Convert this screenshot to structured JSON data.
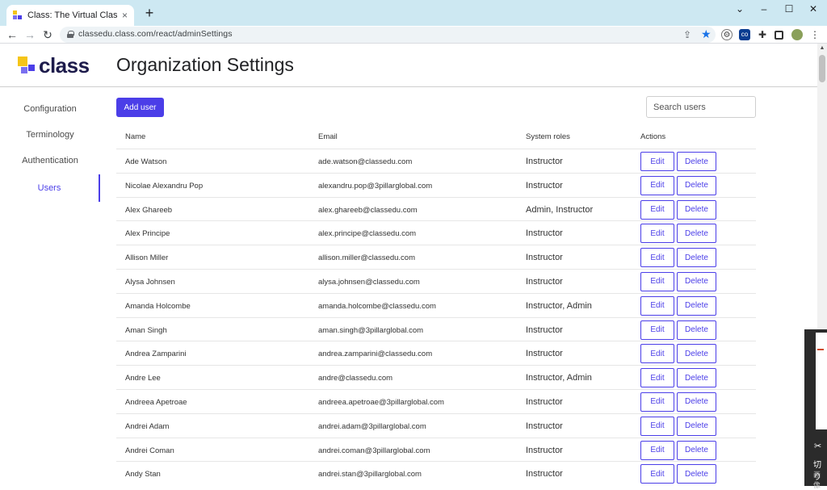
{
  "browser": {
    "tab_title": "Class: The Virtual Classroom Buil",
    "tab_close": "×",
    "new_tab": "+",
    "url": "classedu.class.com/react/adminSettings",
    "controls": {
      "back": "←",
      "forward": "→",
      "reload": "↻"
    },
    "window": {
      "minimize": "–",
      "maximize": "☐",
      "close": "✕"
    },
    "extensions": [
      "gear-icon",
      "co-icon",
      "puzzle-icon",
      "sidepanel-icon",
      "avatar",
      "menu-icon"
    ],
    "extension_label_co": "co"
  },
  "app": {
    "logo_text": "class",
    "page_title": "Organization Settings",
    "brand_color": "#4b3ee8",
    "logo_colors": [
      "#f5c518",
      "#4b3ee8",
      "#7a6ff0"
    ]
  },
  "sidebar": {
    "items": [
      {
        "label": "Configuration",
        "active": false
      },
      {
        "label": "Terminology",
        "active": false
      },
      {
        "label": "Authentication",
        "active": false
      },
      {
        "label": "Users",
        "active": true
      }
    ]
  },
  "users": {
    "add_label": "Add user",
    "search_placeholder": "Search users",
    "columns": {
      "name": "Name",
      "email": "Email",
      "roles": "System roles",
      "actions": "Actions"
    },
    "edit_label": "Edit",
    "delete_label": "Delete",
    "rows": [
      {
        "name": "Ade Watson",
        "email": "ade.watson@classedu.com",
        "roles": "Instructor"
      },
      {
        "name": "Nicolae Alexandru Pop",
        "email": "alexandru.pop@3pillarglobal.com",
        "roles": "Instructor"
      },
      {
        "name": "Alex Ghareeb",
        "email": "alex.ghareeb@classedu.com",
        "roles": "Admin, Instructor"
      },
      {
        "name": "Alex Principe",
        "email": "alex.principe@classedu.com",
        "roles": "Instructor"
      },
      {
        "name": "Allison Miller",
        "email": "allison.miller@classedu.com",
        "roles": "Instructor"
      },
      {
        "name": "Alysa Johnsen",
        "email": "alysa.johnsen@classedu.com",
        "roles": "Instructor"
      },
      {
        "name": "Amanda Holcombe",
        "email": "amanda.holcombe@classedu.com",
        "roles": "Instructor, Admin"
      },
      {
        "name": "Aman Singh",
        "email": "aman.singh@3pillarglobal.com",
        "roles": "Instructor"
      },
      {
        "name": "Andrea Zamparini",
        "email": "andrea.zamparini@classedu.com",
        "roles": "Instructor"
      },
      {
        "name": "Andre Lee",
        "email": "andre@classedu.com",
        "roles": "Instructor, Admin"
      },
      {
        "name": "Andreea Apetroae",
        "email": "andreea.apetroae@3pillarglobal.com",
        "roles": "Instructor"
      },
      {
        "name": "Andrei Adam",
        "email": "andrei.adam@3pillarglobal.com",
        "roles": "Instructor"
      },
      {
        "name": "Andrei Coman",
        "email": "andrei.coman@3pillarglobal.com",
        "roles": "Instructor"
      },
      {
        "name": "Andy Stan",
        "email": "andrei.stan@3pillarglobal.com",
        "roles": "Instructor"
      }
    ]
  },
  "overlay": {
    "line1": "切り",
    "line2": "画像"
  }
}
